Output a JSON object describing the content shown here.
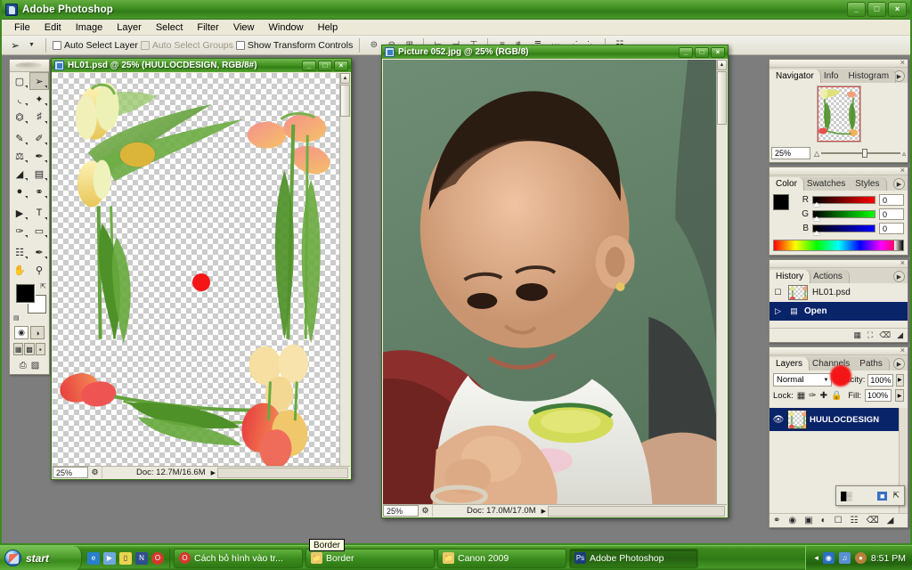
{
  "app": {
    "title": "Adobe Photoshop",
    "window_buttons": {
      "minimize": "_",
      "maximize": "□",
      "close": "×"
    },
    "menus": [
      "File",
      "Edit",
      "Image",
      "Layer",
      "Select",
      "Filter",
      "View",
      "Window",
      "Help"
    ]
  },
  "options_bar": {
    "tool_icon": "move-tool",
    "auto_select_layer": "Auto Select Layer",
    "auto_select_groups": "Auto Select Groups",
    "show_transform_controls": "Show Transform Controls",
    "align_icons": [
      "align-top-edges",
      "align-vertical-centers",
      "align-bottom-edges",
      "align-left-edges",
      "align-horizontal-centers",
      "align-right-edges"
    ],
    "distribute_icons": [
      "distribute-top-edges",
      "distribute-vertical-centers",
      "distribute-bottom-edges",
      "distribute-left-edges",
      "distribute-horizontal-centers",
      "distribute-right-edges"
    ]
  },
  "toolbox": {
    "tools": [
      {
        "name": "marquee-tool",
        "glyph": "⬚",
        "selected": false
      },
      {
        "name": "move-tool",
        "glyph": "↖",
        "selected": true
      },
      {
        "name": "lasso-tool",
        "glyph": "◖",
        "selected": false
      },
      {
        "name": "magic-wand-tool",
        "glyph": "✦",
        "selected": false
      },
      {
        "name": "crop-tool",
        "glyph": "⌧",
        "selected": false
      },
      {
        "name": "slice-tool",
        "glyph": "✂",
        "selected": false
      },
      {
        "name": "healing-brush-tool",
        "glyph": "✐",
        "selected": false
      },
      {
        "name": "brush-tool",
        "glyph": "✎",
        "selected": false
      },
      {
        "name": "clone-stamp-tool",
        "glyph": "⚑",
        "selected": false
      },
      {
        "name": "history-brush-tool",
        "glyph": "✒",
        "selected": false
      },
      {
        "name": "eraser-tool",
        "glyph": "◥",
        "selected": false
      },
      {
        "name": "gradient-tool",
        "glyph": "▤",
        "selected": false
      },
      {
        "name": "blur-tool",
        "glyph": "●",
        "selected": false
      },
      {
        "name": "dodge-tool",
        "glyph": "⚲",
        "selected": false
      },
      {
        "name": "path-selection-tool",
        "glyph": "▶",
        "selected": false
      },
      {
        "name": "type-tool",
        "glyph": "T",
        "selected": false
      },
      {
        "name": "pen-tool",
        "glyph": "✑",
        "selected": false
      },
      {
        "name": "rectangle-shape-tool",
        "glyph": "▭",
        "selected": false
      },
      {
        "name": "notes-tool",
        "glyph": "☰",
        "selected": false
      },
      {
        "name": "eyedropper-tool",
        "glyph": "⚗",
        "selected": false
      },
      {
        "name": "hand-tool",
        "glyph": "✋",
        "selected": false
      },
      {
        "name": "zoom-tool",
        "glyph": "⚲",
        "selected": false
      }
    ],
    "foreground_color": "#000000",
    "background_color": "#ffffff",
    "swap_icon": "swap-colors-icon",
    "default_icon": "default-colors-icon",
    "quick_mask": [
      "standard-mode",
      "quick-mask-mode"
    ],
    "screen_modes": [
      "standard-screen-mode",
      "full-screen-with-menubar",
      "full-screen-mode"
    ],
    "jump_to": [
      "edit-in-imageready-icon"
    ]
  },
  "documents": [
    {
      "name": "doc-hl01",
      "title": "HL01.psd @ 25% (HUULOCDESIGN, RGB/8#)",
      "zoom": "25%",
      "doc_size": "Doc: 12.7M/16.6M",
      "buttons": {
        "minimize": "_",
        "maximize": "□",
        "close": "×"
      }
    },
    {
      "name": "doc-picture052",
      "title": "Picture 052.jpg @ 25% (RGB/8)",
      "zoom": "25%",
      "doc_size": "Doc: 17.0M/17.0M",
      "buttons": {
        "minimize": "_",
        "maximize": "□",
        "close": "×"
      }
    }
  ],
  "navigator": {
    "tabs": [
      "Navigator",
      "Info",
      "Histogram"
    ],
    "active_tab": "Navigator",
    "zoom": "25%",
    "menu_icon": "panel-menu-icon",
    "zoom_out_icon": "zoom-out-icon",
    "zoom_in_icon": "zoom-in-icon"
  },
  "color_panel": {
    "tabs": [
      "Color",
      "Swatches",
      "Styles"
    ],
    "active_tab": "Color",
    "channels": [
      {
        "label": "R",
        "value": "0",
        "color": "#ff0000"
      },
      {
        "label": "G",
        "value": "0",
        "color": "#00ff00"
      },
      {
        "label": "B",
        "value": "0",
        "color": "#0000ff"
      }
    ],
    "foreground": "#000000",
    "background": "#ffffff"
  },
  "history_panel": {
    "tabs": [
      "History",
      "Actions"
    ],
    "active_tab": "History",
    "snapshot": "HL01.psd",
    "states": [
      {
        "label": "Open",
        "selected": true
      }
    ],
    "footer_icons": [
      "new-document-from-state-icon",
      "new-snapshot-icon",
      "delete-state-icon"
    ]
  },
  "layers_panel": {
    "tabs": [
      "Layers",
      "Channels",
      "Paths"
    ],
    "active_tab": "Layers",
    "blend_mode": "Normal",
    "opacity_label": "Opacity:",
    "opacity_value": "100%",
    "lock_label": "Lock:",
    "fill_label": "Fill:",
    "fill_value": "100%",
    "lock_icons": [
      "lock-transparent-pixels-icon",
      "lock-image-pixels-icon",
      "lock-position-icon",
      "lock-all-icon"
    ],
    "layers": [
      {
        "name": "HUULOCDESIGN",
        "visible": true,
        "selected": true
      }
    ],
    "footer_icons": [
      "link-layers-icon",
      "layer-style-icon",
      "layer-mask-icon",
      "adjustment-layer-icon",
      "new-group-icon",
      "new-layer-icon",
      "delete-layer-icon"
    ],
    "flyout_icons": [
      "levels-icon",
      "solid-color-icon"
    ]
  },
  "taskbar": {
    "start_label": "start",
    "quick_launch": [
      "internet-explorer-icon",
      "media-player-icon",
      "notepad-icon",
      "nero-icon",
      "opera-icon"
    ],
    "tasks": [
      {
        "label": "Cách bỏ hình vào tr...",
        "icon": "opera-icon",
        "active": false
      },
      {
        "label": "Border",
        "icon": "folder-icon",
        "active": false
      },
      {
        "label": "Canon 2009",
        "icon": "folder-icon",
        "active": false
      },
      {
        "label": "Adobe Photoshop",
        "icon": "photoshop-icon",
        "active": true
      }
    ],
    "tray_icons": [
      "show-hidden-icons-arrow",
      "network-icon",
      "volume-icon",
      "antivirus-icon"
    ],
    "time": "8:51 PM"
  },
  "tooltip": {
    "text": "Border"
  },
  "annotation": {
    "marker_color": "#f41616",
    "arrow_color": "#c03030",
    "markers": [
      "cheek-marker",
      "layer-row-marker"
    ]
  }
}
